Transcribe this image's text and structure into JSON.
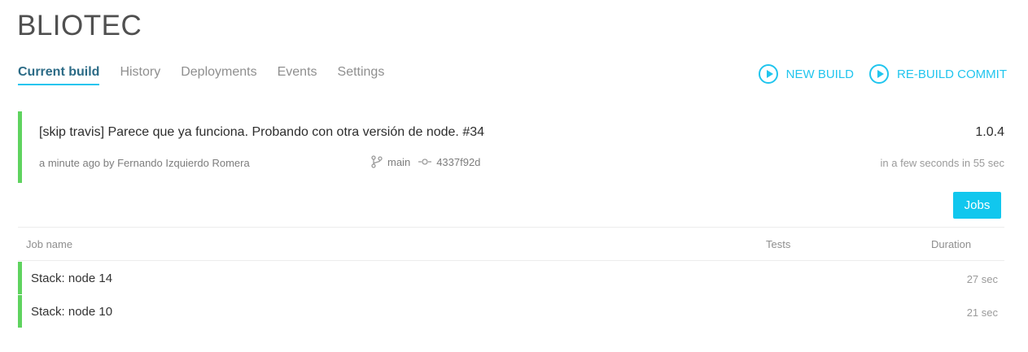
{
  "app": {
    "title": "BLIOTEC"
  },
  "tabs": [
    {
      "label": "Current build",
      "active": true
    },
    {
      "label": "History",
      "active": false
    },
    {
      "label": "Deployments",
      "active": false
    },
    {
      "label": "Events",
      "active": false
    },
    {
      "label": "Settings",
      "active": false
    }
  ],
  "actions": {
    "new_build": "NEW BUILD",
    "rebuild_commit": "RE-BUILD COMMIT",
    "icon": "play-circle-icon"
  },
  "build": {
    "message": "[skip travis] Parece que ya funciona. Probando con otra versión de node. #34",
    "version": "1.0.4",
    "meta": "a minute ago by Fernando Izquierdo Romera",
    "branch": "main",
    "commit": "4337f92d",
    "time": "in a few seconds in 55 sec",
    "status_color": "#5fd35f"
  },
  "jobs_button": "Jobs",
  "table": {
    "headers": {
      "job_name": "Job name",
      "tests": "Tests",
      "duration": "Duration"
    },
    "rows": [
      {
        "name": "Stack: node 14",
        "tests": "",
        "duration": "27 sec"
      },
      {
        "name": "Stack: node 10",
        "tests": "",
        "duration": "21 sec"
      }
    ]
  },
  "colors": {
    "accent": "#20c5ee",
    "success": "#5fd35f",
    "button": "#11c7ee"
  }
}
